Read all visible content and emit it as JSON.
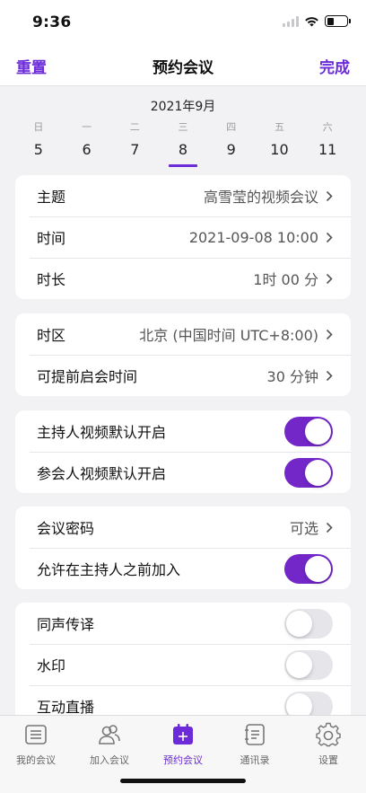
{
  "status_bar": {
    "time": "9:36"
  },
  "nav": {
    "left": "重置",
    "title": "预约会议",
    "right": "完成"
  },
  "calendar": {
    "month": "2021年9月",
    "weekdays": [
      "日",
      "一",
      "二",
      "三",
      "四",
      "五",
      "六"
    ],
    "days": [
      "5",
      "6",
      "7",
      "8",
      "9",
      "10",
      "11"
    ],
    "selected_day": "8"
  },
  "card1": {
    "rows": [
      {
        "label": "主题",
        "value": "高雪莹的视频会议"
      },
      {
        "label": "时间",
        "value": "2021-09-08 10:00"
      },
      {
        "label": "时长",
        "value": "1时 00 分"
      }
    ]
  },
  "card2": {
    "rows": [
      {
        "label": "时区",
        "value": "北京 (中国时间 UTC+8:00)"
      },
      {
        "label": "可提前启会时间",
        "value": "30 分钟"
      }
    ]
  },
  "card3": {
    "rows": [
      {
        "label": "主持人视频默认开启",
        "toggle": true
      },
      {
        "label": "参会人视频默认开启",
        "toggle": true
      }
    ]
  },
  "card4": {
    "rows": [
      {
        "label": "会议密码",
        "value": "可选"
      },
      {
        "label": "允许在主持人之前加入",
        "toggle": true
      }
    ]
  },
  "card5": {
    "rows": [
      {
        "label": "同声传译",
        "toggle": false
      },
      {
        "label": "水印",
        "toggle": false
      },
      {
        "label": "互动直播",
        "toggle": false
      }
    ]
  },
  "tab_bar": {
    "items": [
      {
        "label": "我的会议",
        "icon": "list-icon",
        "active": false
      },
      {
        "label": "加入会议",
        "icon": "people-icon",
        "active": false
      },
      {
        "label": "预约会议",
        "icon": "calendar-add-icon",
        "active": true
      },
      {
        "label": "通讯录",
        "icon": "contacts-icon",
        "active": false
      },
      {
        "label": "设置",
        "icon": "gear-icon",
        "active": false
      }
    ]
  },
  "colors": {
    "accent": "#6b2bd8",
    "toggle_on": "#7327c9",
    "background": "#f2f2f4"
  }
}
